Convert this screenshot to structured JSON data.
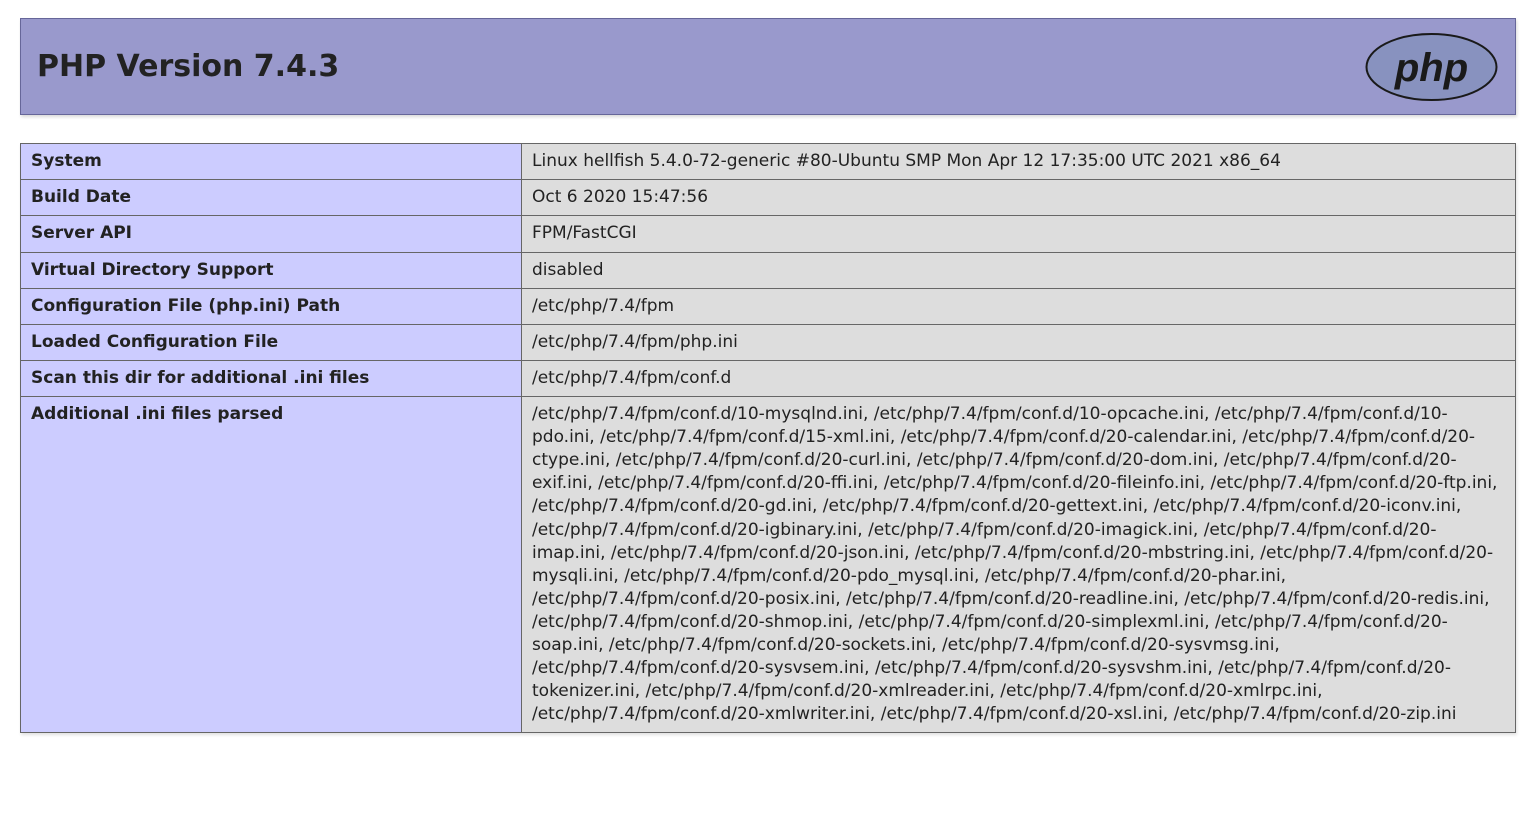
{
  "header": {
    "title": "PHP Version 7.4.3",
    "logo_alt": "php"
  },
  "rows": [
    {
      "label": "System",
      "value": "Linux hellfish 5.4.0-72-generic #80-Ubuntu SMP Mon Apr 12 17:35:00 UTC 2021 x86_64"
    },
    {
      "label": "Build Date",
      "value": "Oct 6 2020 15:47:56"
    },
    {
      "label": "Server API",
      "value": "FPM/FastCGI"
    },
    {
      "label": "Virtual Directory Support",
      "value": "disabled"
    },
    {
      "label": "Configuration File (php.ini) Path",
      "value": "/etc/php/7.4/fpm"
    },
    {
      "label": "Loaded Configuration File",
      "value": "/etc/php/7.4/fpm/php.ini"
    },
    {
      "label": "Scan this dir for additional .ini files",
      "value": "/etc/php/7.4/fpm/conf.d"
    },
    {
      "label": "Additional .ini files parsed",
      "value": "/etc/php/7.4/fpm/conf.d/10-mysqlnd.ini, /etc/php/7.4/fpm/conf.d/10-opcache.ini, /etc/php/7.4/fpm/conf.d/10-pdo.ini, /etc/php/7.4/fpm/conf.d/15-xml.ini, /etc/php/7.4/fpm/conf.d/20-calendar.ini, /etc/php/7.4/fpm/conf.d/20-ctype.ini, /etc/php/7.4/fpm/conf.d/20-curl.ini, /etc/php/7.4/fpm/conf.d/20-dom.ini, /etc/php/7.4/fpm/conf.d/20-exif.ini, /etc/php/7.4/fpm/conf.d/20-ffi.ini, /etc/php/7.4/fpm/conf.d/20-fileinfo.ini, /etc/php/7.4/fpm/conf.d/20-ftp.ini, /etc/php/7.4/fpm/conf.d/20-gd.ini, /etc/php/7.4/fpm/conf.d/20-gettext.ini, /etc/php/7.4/fpm/conf.d/20-iconv.ini, /etc/php/7.4/fpm/conf.d/20-igbinary.ini, /etc/php/7.4/fpm/conf.d/20-imagick.ini, /etc/php/7.4/fpm/conf.d/20-imap.ini, /etc/php/7.4/fpm/conf.d/20-json.ini, /etc/php/7.4/fpm/conf.d/20-mbstring.ini, /etc/php/7.4/fpm/conf.d/20-mysqli.ini, /etc/php/7.4/fpm/conf.d/20-pdo_mysql.ini, /etc/php/7.4/fpm/conf.d/20-phar.ini, /etc/php/7.4/fpm/conf.d/20-posix.ini, /etc/php/7.4/fpm/conf.d/20-readline.ini, /etc/php/7.4/fpm/conf.d/20-redis.ini, /etc/php/7.4/fpm/conf.d/20-shmop.ini, /etc/php/7.4/fpm/conf.d/20-simplexml.ini, /etc/php/7.4/fpm/conf.d/20-soap.ini, /etc/php/7.4/fpm/conf.d/20-sockets.ini, /etc/php/7.4/fpm/conf.d/20-sysvmsg.ini, /etc/php/7.4/fpm/conf.d/20-sysvsem.ini, /etc/php/7.4/fpm/conf.d/20-sysvshm.ini, /etc/php/7.4/fpm/conf.d/20-tokenizer.ini, /etc/php/7.4/fpm/conf.d/20-xmlreader.ini, /etc/php/7.4/fpm/conf.d/20-xmlrpc.ini, /etc/php/7.4/fpm/conf.d/20-xmlwriter.ini, /etc/php/7.4/fpm/conf.d/20-xsl.ini, /etc/php/7.4/fpm/conf.d/20-zip.ini"
    }
  ]
}
